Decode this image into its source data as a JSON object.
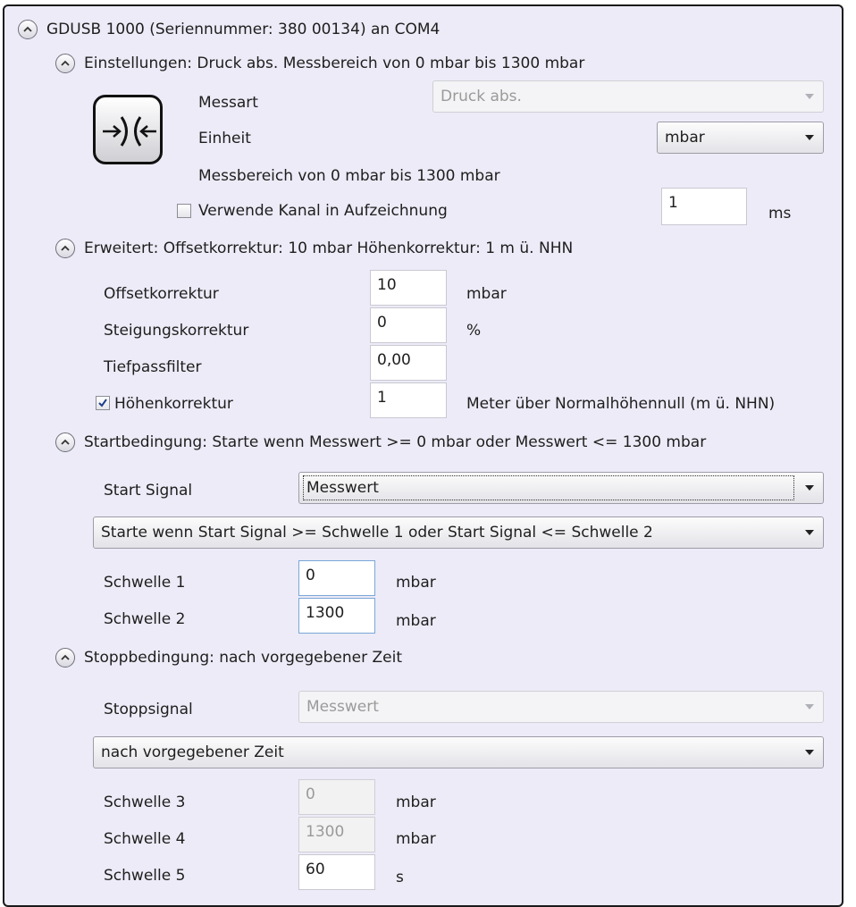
{
  "device": {
    "title": "GDUSB 1000 (Seriennummer: 380 00134) an COM4"
  },
  "settings": {
    "header": "Einstellungen: Druck abs. Messbereich von 0 mbar bis 1300 mbar",
    "icon": "pressure-sensor-icon",
    "measure_type_label": "Messart",
    "measure_type_value": "Druck abs.",
    "unit_label": "Einheit",
    "unit_value": "mbar",
    "range_text": "Messbereich von 0 mbar bis 1300 mbar",
    "use_channel_label": "Verwende Kanal in Aufzeichnung",
    "use_channel_checked": false,
    "interval_value": "1",
    "interval_unit": "ms"
  },
  "advanced": {
    "header": "Erweitert: Offsetkorrektur: 10 mbar Höhenkorrektur: 1 m ü. NHN",
    "offset_label": "Offsetkorrektur",
    "offset_value": "10",
    "offset_unit": "mbar",
    "slope_label": "Steigungskorrektur",
    "slope_value": "0",
    "slope_unit": "%",
    "lowpass_label": "Tiefpassfilter",
    "lowpass_value": "0,00",
    "altitude_label": "Höhenkorrektur",
    "altitude_checked": true,
    "altitude_value": "1",
    "altitude_unit": "Meter über Normalhöhennull (m ü. NHN)"
  },
  "start": {
    "header": "Startbedingung: Starte wenn Messwert >= 0 mbar oder Messwert <= 1300 mbar",
    "signal_label": "Start Signal",
    "signal_value": "Messwert",
    "condition_value": "Starte wenn Start Signal >= Schwelle 1  oder Start Signal <= Schwelle 2",
    "threshold1_label": "Schwelle 1",
    "threshold1_value": "0",
    "threshold1_unit": "mbar",
    "threshold2_label": "Schwelle 2",
    "threshold2_value": "1300",
    "threshold2_unit": "mbar"
  },
  "stop": {
    "header": "Stoppbedingung: nach vorgegebener Zeit",
    "signal_label": "Stoppsignal",
    "signal_value": "Messwert",
    "condition_value": "nach vorgegebener Zeit",
    "threshold3_label": "Schwelle 3",
    "threshold3_value": "0",
    "threshold3_unit": "mbar",
    "threshold4_label": "Schwelle 4",
    "threshold4_value": "1300",
    "threshold4_unit": "mbar",
    "threshold5_label": "Schwelle 5",
    "threshold5_value": "60",
    "threshold5_unit": "s"
  },
  "colors": {
    "panel_bg": "#ecebf7",
    "focus_border": "#7aa6d8",
    "disabled_text": "#9a9a9a"
  }
}
